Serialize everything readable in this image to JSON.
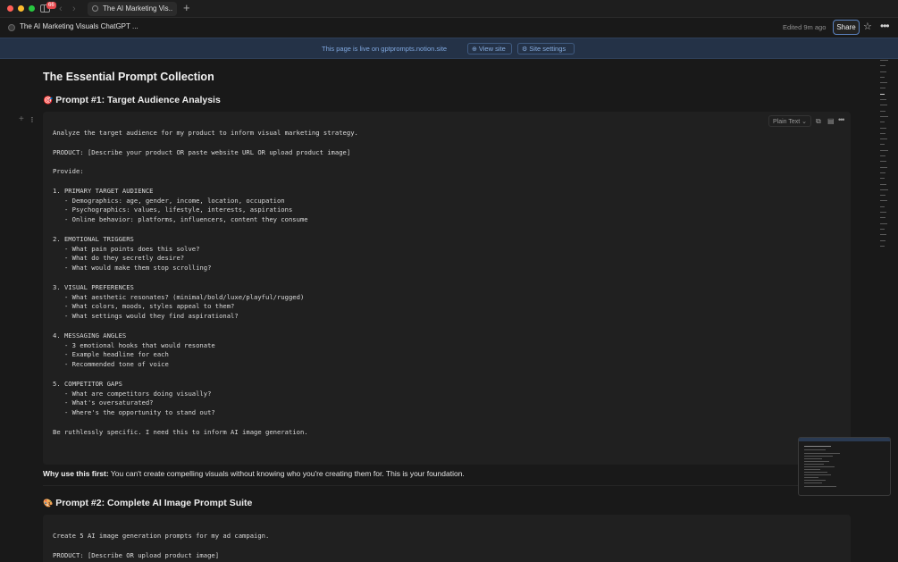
{
  "browser": {
    "tab_title": "The AI Marketing Vis...",
    "tab_count_badge": "66"
  },
  "topbar": {
    "breadcrumb": "The AI Marketing Visuals ChatGPT ...",
    "edited": "Edited 9m ago",
    "share_label": "Share"
  },
  "banner": {
    "text": "This page is live on gptprompts.notion.site",
    "view_site": "View site",
    "site_settings": "Site settings"
  },
  "page": {
    "title": "The Essential Prompt Collection",
    "prompt1_emoji": "🎯",
    "prompt1_heading": "Prompt #1: Target Audience Analysis",
    "code_language": "Plain Text",
    "code1": "Analyze the target audience for my product to inform visual marketing strategy.\n\nPRODUCT: [Describe your product OR paste website URL OR upload product image]\n\nProvide:\n\n1. PRIMARY TARGET AUDIENCE\n   - Demographics: age, gender, income, location, occupation\n   - Psychographics: values, lifestyle, interests, aspirations\n   - Online behavior: platforms, influencers, content they consume\n\n2. EMOTIONAL TRIGGERS\n   - What pain points does this solve?\n   - What do they secretly desire?\n   - What would make them stop scrolling?\n\n3. VISUAL PREFERENCES\n   - What aesthetic resonates? (minimal/bold/luxe/playful/rugged)\n   - What colors, moods, styles appeal to them?\n   - What settings would they find aspirational?\n\n4. MESSAGING ANGLES\n   - 3 emotional hooks that would resonate\n   - Example headline for each\n   - Recommended tone of voice\n\n5. COMPETITOR GAPS\n   - What are competitors doing visually?\n   - What's oversaturated?\n   - Where's the opportunity to stand out?\n\nBe ruthlessly specific. I need this to inform AI image generation.",
    "why_label": "Why use this first:",
    "why_text": " You can't create compelling visuals without knowing who you're creating them for. This is your foundation.",
    "prompt2_emoji": "🎨",
    "prompt2_heading": "Prompt #2: Complete AI Image Prompt Suite",
    "code2": "Create 5 AI image generation prompts for my ad campaign.\n\nPRODUCT: [Describe OR upload product image]"
  },
  "icons": {
    "star": "star-icon",
    "more": "more-horizontal-icon",
    "globe": "globe-icon",
    "gear": "gear-icon"
  }
}
